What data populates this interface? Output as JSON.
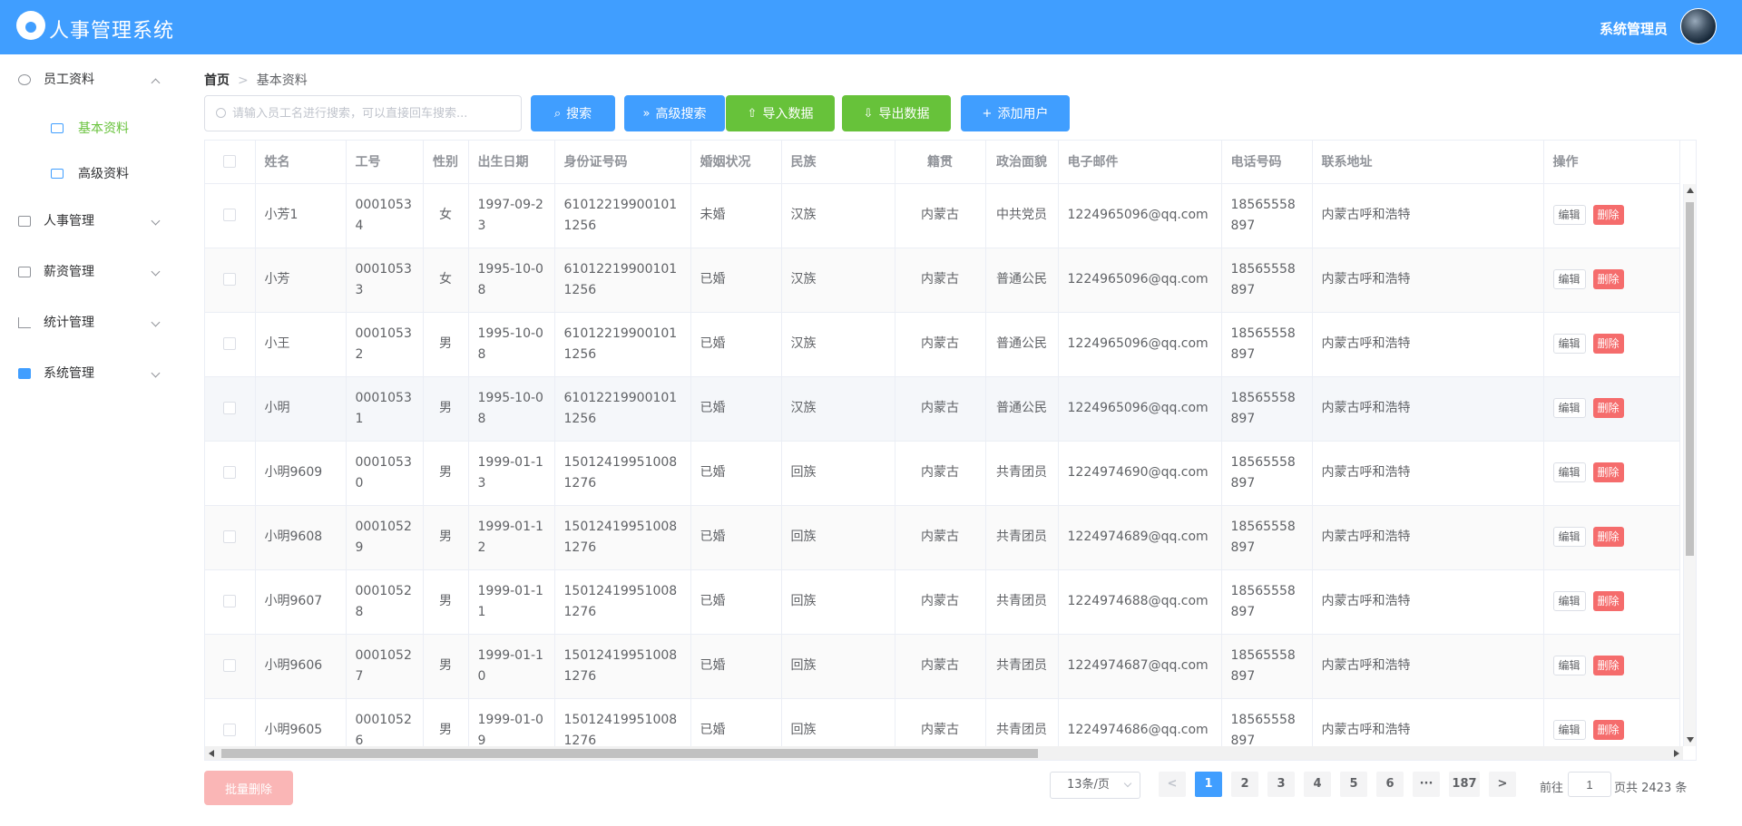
{
  "header": {
    "title": "人事管理系统",
    "user_name": "系统管理员"
  },
  "sidebar": {
    "groups": [
      {
        "label": "员工资料",
        "icon": "user-circle-icon",
        "expanded": true,
        "children": [
          {
            "label": "基本资料",
            "active": true
          },
          {
            "label": "高级资料",
            "active": false
          }
        ]
      },
      {
        "label": "人事管理",
        "icon": "id-card-icon",
        "expanded": false
      },
      {
        "label": "薪资管理",
        "icon": "money-icon",
        "expanded": false
      },
      {
        "label": "统计管理",
        "icon": "bar-chart-icon",
        "expanded": false
      },
      {
        "label": "系统管理",
        "icon": "windows-icon",
        "expanded": false
      }
    ]
  },
  "breadcrumb": {
    "home": "首页",
    "current": "基本资料"
  },
  "toolbar": {
    "search_placeholder": "请输入员工名进行搜索，可以直接回车搜索...",
    "search_label": "搜索",
    "advanced_label": "高级搜索",
    "import_label": "导入数据",
    "export_label": "导出数据",
    "add_label": "添加用户"
  },
  "table": {
    "columns": [
      "姓名",
      "工号",
      "性别",
      "出生日期",
      "身份证号码",
      "婚姻状况",
      "民族",
      "籍贯",
      "政治面貌",
      "电子邮件",
      "电话号码",
      "联系地址",
      "操作"
    ],
    "edit_label": "编辑",
    "delete_label": "删除",
    "rows": [
      [
        "小芳1",
        "00010534",
        "女",
        "1997-09-23",
        "610122199001011256",
        "未婚",
        "汉族",
        "内蒙古",
        "中共党员",
        "1224965096@qq.com",
        "18565558897",
        "内蒙古呼和浩特"
      ],
      [
        "小芳",
        "00010533",
        "女",
        "1995-10-08",
        "610122199001011256",
        "已婚",
        "汉族",
        "内蒙古",
        "普通公民",
        "1224965096@qq.com",
        "18565558897",
        "内蒙古呼和浩特"
      ],
      [
        "小王",
        "00010532",
        "男",
        "1995-10-08",
        "610122199001011256",
        "已婚",
        "汉族",
        "内蒙古",
        "普通公民",
        "1224965096@qq.com",
        "18565558897",
        "内蒙古呼和浩特"
      ],
      [
        "小明",
        "00010531",
        "男",
        "1995-10-08",
        "610122199001011256",
        "已婚",
        "汉族",
        "内蒙古",
        "普通公民",
        "1224965096@qq.com",
        "18565558897",
        "内蒙古呼和浩特"
      ],
      [
        "小明9609",
        "00010530",
        "男",
        "1999-01-13",
        "150124199510081276",
        "已婚",
        "回族",
        "内蒙古",
        "共青团员",
        "1224974690@qq.com",
        "18565558897",
        "内蒙古呼和浩特"
      ],
      [
        "小明9608",
        "00010529",
        "男",
        "1999-01-12",
        "150124199510081276",
        "已婚",
        "回族",
        "内蒙古",
        "共青团员",
        "1224974689@qq.com",
        "18565558897",
        "内蒙古呼和浩特"
      ],
      [
        "小明9607",
        "00010528",
        "男",
        "1999-01-11",
        "150124199510081276",
        "已婚",
        "回族",
        "内蒙古",
        "共青团员",
        "1224974688@qq.com",
        "18565558897",
        "内蒙古呼和浩特"
      ],
      [
        "小明9606",
        "00010527",
        "男",
        "1999-01-10",
        "150124199510081276",
        "已婚",
        "回族",
        "内蒙古",
        "共青团员",
        "1224974687@qq.com",
        "18565558897",
        "内蒙古呼和浩特"
      ],
      [
        "小明9605",
        "00010526",
        "男",
        "1999-01-09",
        "150124199510081276",
        "已婚",
        "回族",
        "内蒙古",
        "共青团员",
        "1224974686@qq.com",
        "18565558897",
        "内蒙古呼和浩特"
      ]
    ]
  },
  "footer": {
    "batch_delete_label": "批量删除",
    "page_size": "13条/页",
    "pages": [
      "1",
      "2",
      "3",
      "4",
      "5",
      "6",
      "···",
      "187"
    ],
    "current_page": "1",
    "goto_label": "前往",
    "goto_value": "1",
    "goto_suffix": "页共 2423 条"
  },
  "colors": {
    "primary": "#409eff",
    "success": "#67c23a",
    "danger": "#f56c6c",
    "active_menu": "#67c23a"
  }
}
